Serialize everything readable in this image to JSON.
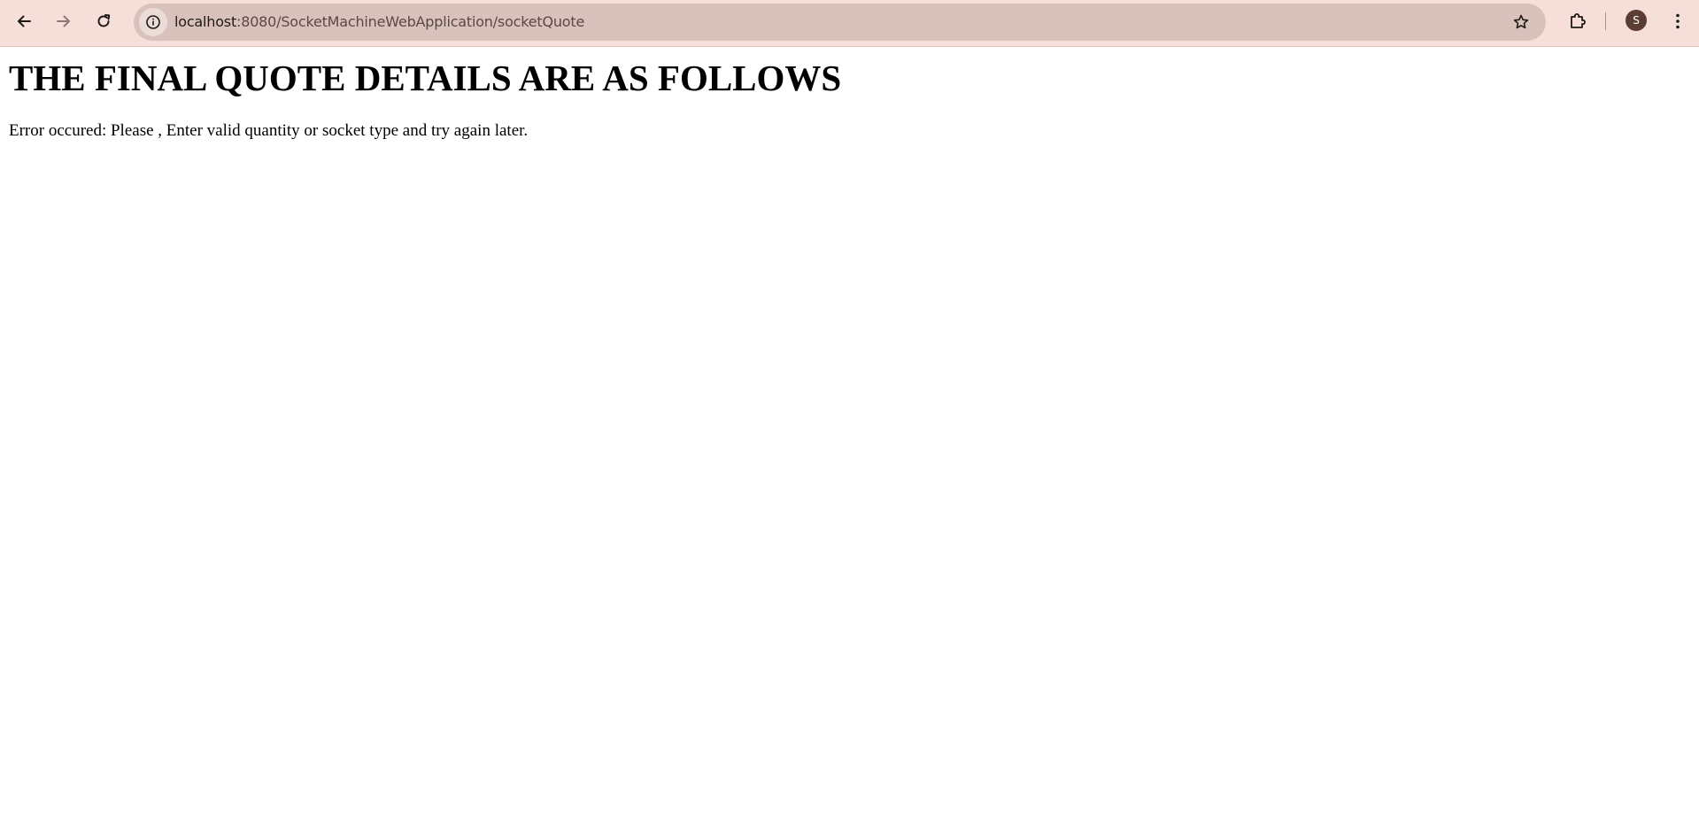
{
  "browser": {
    "url": {
      "host": "localhost",
      "rest": ":8080/SocketMachineWebApplication/socketQuote"
    },
    "profile_initial": "S",
    "icons": {
      "back": "back-arrow-icon",
      "forward": "forward-arrow-icon",
      "reload": "reload-icon",
      "site_info": "info-icon",
      "bookmark": "star-icon",
      "extensions": "puzzle-piece-icon",
      "menu": "kebab-menu-icon"
    },
    "colors": {
      "toolbar": "#f5dfd8",
      "omnibox": "#d9c2bc",
      "avatar": "#5c3d34"
    }
  },
  "page": {
    "heading": "THE FINAL QUOTE DETAILS ARE AS FOLLOWS",
    "error_message": "Error occured: Please , Enter valid quantity or socket type and try again later."
  }
}
